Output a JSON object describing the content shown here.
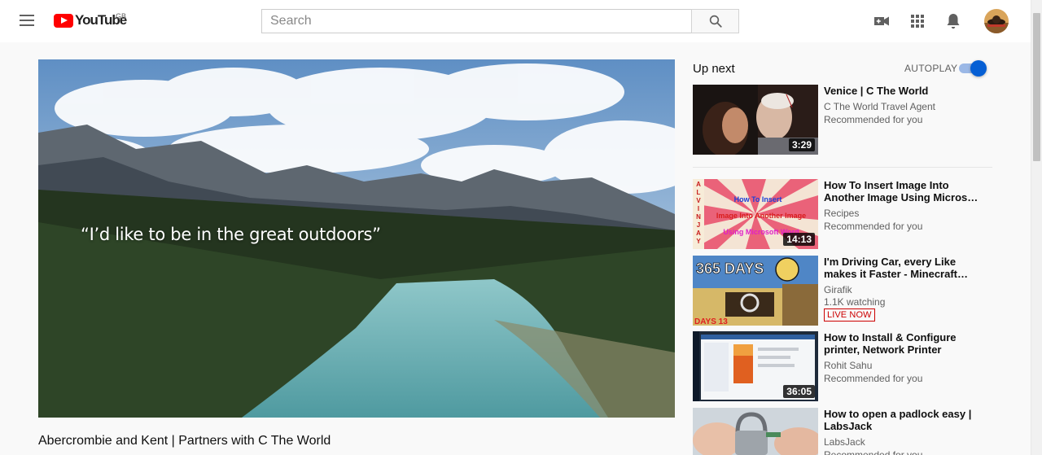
{
  "header": {
    "logo_text": "YouTube",
    "region": "GB",
    "search_placeholder": "Search"
  },
  "player": {
    "caption": "“I’d like to be in the great outdoors”"
  },
  "video": {
    "title": "Abercrombie and Kent | Partners with C The World"
  },
  "sidebar": {
    "up_next": "Up next",
    "autoplay": "AUTOPLAY",
    "autoplay_on": true,
    "items": [
      {
        "title": "Venice | C The World",
        "channel": "C The World Travel Agent",
        "meta": "Recommended for you",
        "duration": "3:29"
      },
      {
        "title_line1": "How To Insert Image Into",
        "title_line2": "Another Image Using Microsof…",
        "channel": "Recipes",
        "meta": "Recommended for you",
        "duration": "14:13",
        "thumb_text1": "How To Insert",
        "thumb_text2": "Image Into Another Image",
        "thumb_text3": "Using Microsoft Word",
        "thumb_side": [
          "A",
          "L",
          "V",
          "I",
          "N",
          "J",
          "A",
          "Y"
        ]
      },
      {
        "title_line1": "I'm Driving Car, every Like",
        "title_line2": "makes it Faster - Minecraft…",
        "channel": "Girafik",
        "meta": "1.1K watching",
        "badge": "LIVE NOW",
        "thumb_text1": "365 DAYS",
        "thumb_text2": "DAYS 13"
      },
      {
        "title_line1": "How to Install & Configure",
        "title_line2": "printer, Network Printer",
        "channel": "Rohit Sahu",
        "meta": "Recommended for you",
        "duration": "36:05"
      },
      {
        "title_line1": "How to open a padlock easy |",
        "title_line2": "LabsJack",
        "channel": "LabsJack",
        "meta": "Recommended for you"
      }
    ]
  },
  "colors": {
    "brand_red": "#ff0000",
    "accent_blue": "#065fd4",
    "live_red": "#cc0000"
  }
}
